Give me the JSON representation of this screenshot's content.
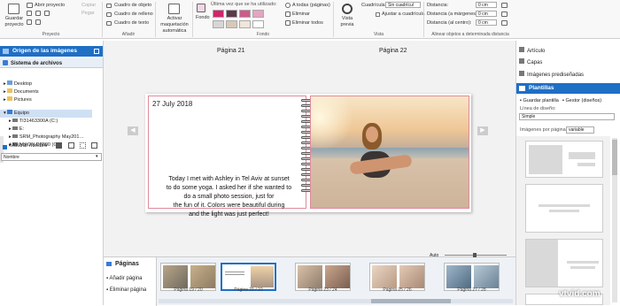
{
  "ribbon": {
    "save_project": "Guardar proyecto",
    "open_project": "Abrir proyecto",
    "copy": "Copiar",
    "paste": "Pegar",
    "group_project": "Proyecto",
    "photo_box": "Cuadro de objeto",
    "fill_box": "Cuadro de relleno",
    "text_box": "Cuadro de texto",
    "group_add": "Añadir",
    "auto_layout": "Activar maquetación automática",
    "background": "Fondo",
    "last_used": "Última vez que se ha utilizado:",
    "swatches": [
      "#d4236b",
      "#5b3a4a",
      "#cf5a8a",
      "#e7a4c2",
      "#d6d6d6",
      "#d8c9b5",
      "#f0e6d8",
      "#ffffff"
    ],
    "to_all_pages": "A todas (páginas)",
    "delete": "Eliminar",
    "delete_all": "Eliminar todos",
    "group_background": "Fondo",
    "preview": "Vista previa",
    "grid_label": "Cuadrícula:",
    "grid_value": "Sin cuadrícul",
    "snap_grid": "Ajustar a cuadrícula",
    "group_view": "Vista",
    "distance": "Distancia:",
    "distance_margins": "Distancia (a márgenes):",
    "distance_center": "Distancia (al centro):",
    "cm_value": "0 cm",
    "align_group": "Alinear objetos a determinada distancia"
  },
  "left": {
    "header": "Origen de las imágenes",
    "file_system": "Sistema de archivos",
    "tree": [
      "Desktop",
      "Documents",
      "Pictures"
    ],
    "computer": "Equipo",
    "drives": [
      "TI31463300A (C:)",
      "E:",
      "SRM_Photography May201…",
      "NIKON D7000 (G:)"
    ],
    "show_name": "Mostrar nombre",
    "sort_value": "Nombre"
  },
  "canvas": {
    "page_left": "Página 21",
    "page_right": "Página 22",
    "date": "27 July 2018",
    "story_lines": [
      "Today I met with Ashley in Tel Aviv at sunset",
      "to do some yoga. I asked her if she wanted to",
      "do a small photo session, just for",
      "the fun of it. Colors were beautiful during",
      "and the light was just perfect!"
    ]
  },
  "right": {
    "article": "Artículo",
    "layers": "Capas",
    "presets": "Imágenes prediseñadas",
    "templates": "Plantillas",
    "save_template": "Guardar plantilla",
    "manager": "Gestor (diseños)",
    "design_line": "Línea de diseño:",
    "design_value": "Simple",
    "images_per_page": "Imágenes por página:",
    "images_value": "variable"
  },
  "bottom": {
    "pages": "Páginas",
    "add_page": "Añadir página",
    "delete_page": "Eliminar página",
    "zoom_label": "Auto",
    "thumbs": [
      "Página 19 / 20",
      "Página 21 / 22",
      "Página 23 / 24",
      "Página 25 / 26",
      "Página 27 / 28"
    ]
  },
  "watermark": "vtvid.com"
}
